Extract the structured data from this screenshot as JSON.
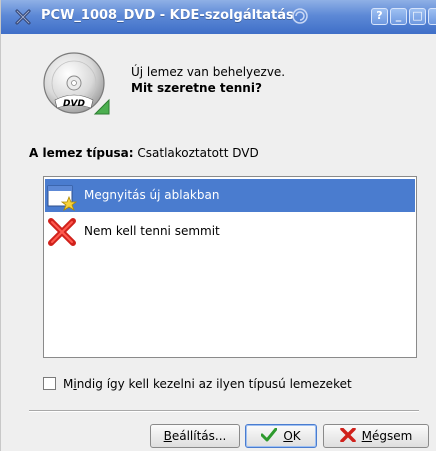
{
  "window": {
    "title": "PCW_1008_DVD - KDE-szolgáltatás",
    "buttons": {
      "help": "?",
      "minimize": "_",
      "maximize": "□"
    }
  },
  "message": {
    "line1": "Új lemez van behelyezve.",
    "line2": "Mit szeretne tenni?"
  },
  "disc_type": {
    "label": "A lemez típusa:",
    "value": "Csatlakoztatott DVD"
  },
  "actions": [
    {
      "label": "Megnyitás új ablakban",
      "icon": "window-new-icon",
      "selected": true
    },
    {
      "label": "Nem kell tenni semmit",
      "icon": "red-x-icon",
      "selected": false
    }
  ],
  "remember": {
    "label_pre": "M",
    "label_accel": "i",
    "label_post": "ndig így kell kezelni az ilyen típusú lemezeket",
    "checked": false
  },
  "buttons": {
    "settings_accel": "B",
    "settings_rest": "eállítás...",
    "ok_accel": "O",
    "ok_rest": "K",
    "cancel_accel": "M",
    "cancel_rest": "égsem"
  },
  "colors": {
    "titlebar": "#5d89d6",
    "selection": "#4a7ccf",
    "background": "#efefef"
  }
}
